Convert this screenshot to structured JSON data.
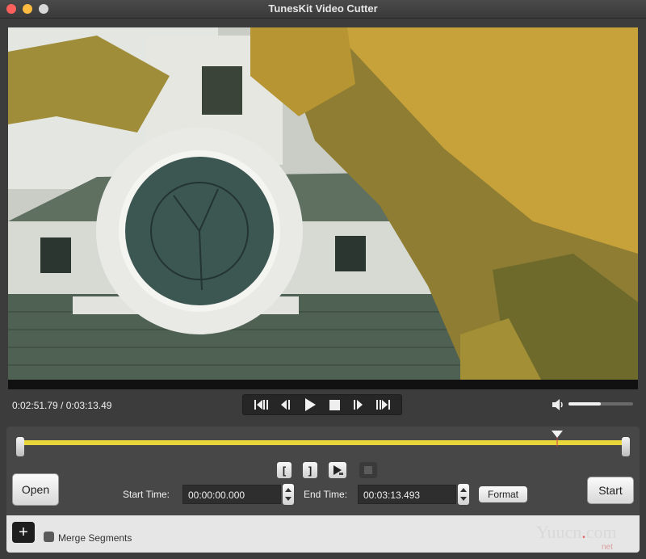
{
  "window": {
    "title": "TunesKit Video Cutter"
  },
  "player": {
    "time_readout": "0:02:51.79 / 0:03:13.49",
    "volume_level": 0.5
  },
  "transport": {
    "icons": [
      "step-back-icon",
      "frame-back-icon",
      "play-icon",
      "stop-icon",
      "frame-forward-icon",
      "step-forward-icon"
    ]
  },
  "trim": {
    "selection_start_fraction": 0.0,
    "selection_end_fraction": 1.0,
    "playhead_fraction": 0.886
  },
  "controls": {
    "open_label": "Open",
    "start_label": "Start",
    "format_label": "Format",
    "start_time_label": "Start Time:",
    "start_time_value": "00:00:00.000",
    "end_time_label": "End Time:",
    "end_time_value": "00:03:13.493",
    "set_start_symbol": "[",
    "set_end_symbol": "]"
  },
  "bottom": {
    "add_symbol": "+",
    "merge_label": "Merge Segments"
  },
  "watermark": {
    "text_main": "Yuucn",
    "text_dot": ".",
    "text_tail": "com",
    "text_sub": "net"
  },
  "colors": {
    "track": "#e8d63a",
    "background": "#3c3c3c",
    "panel": "#474747"
  }
}
